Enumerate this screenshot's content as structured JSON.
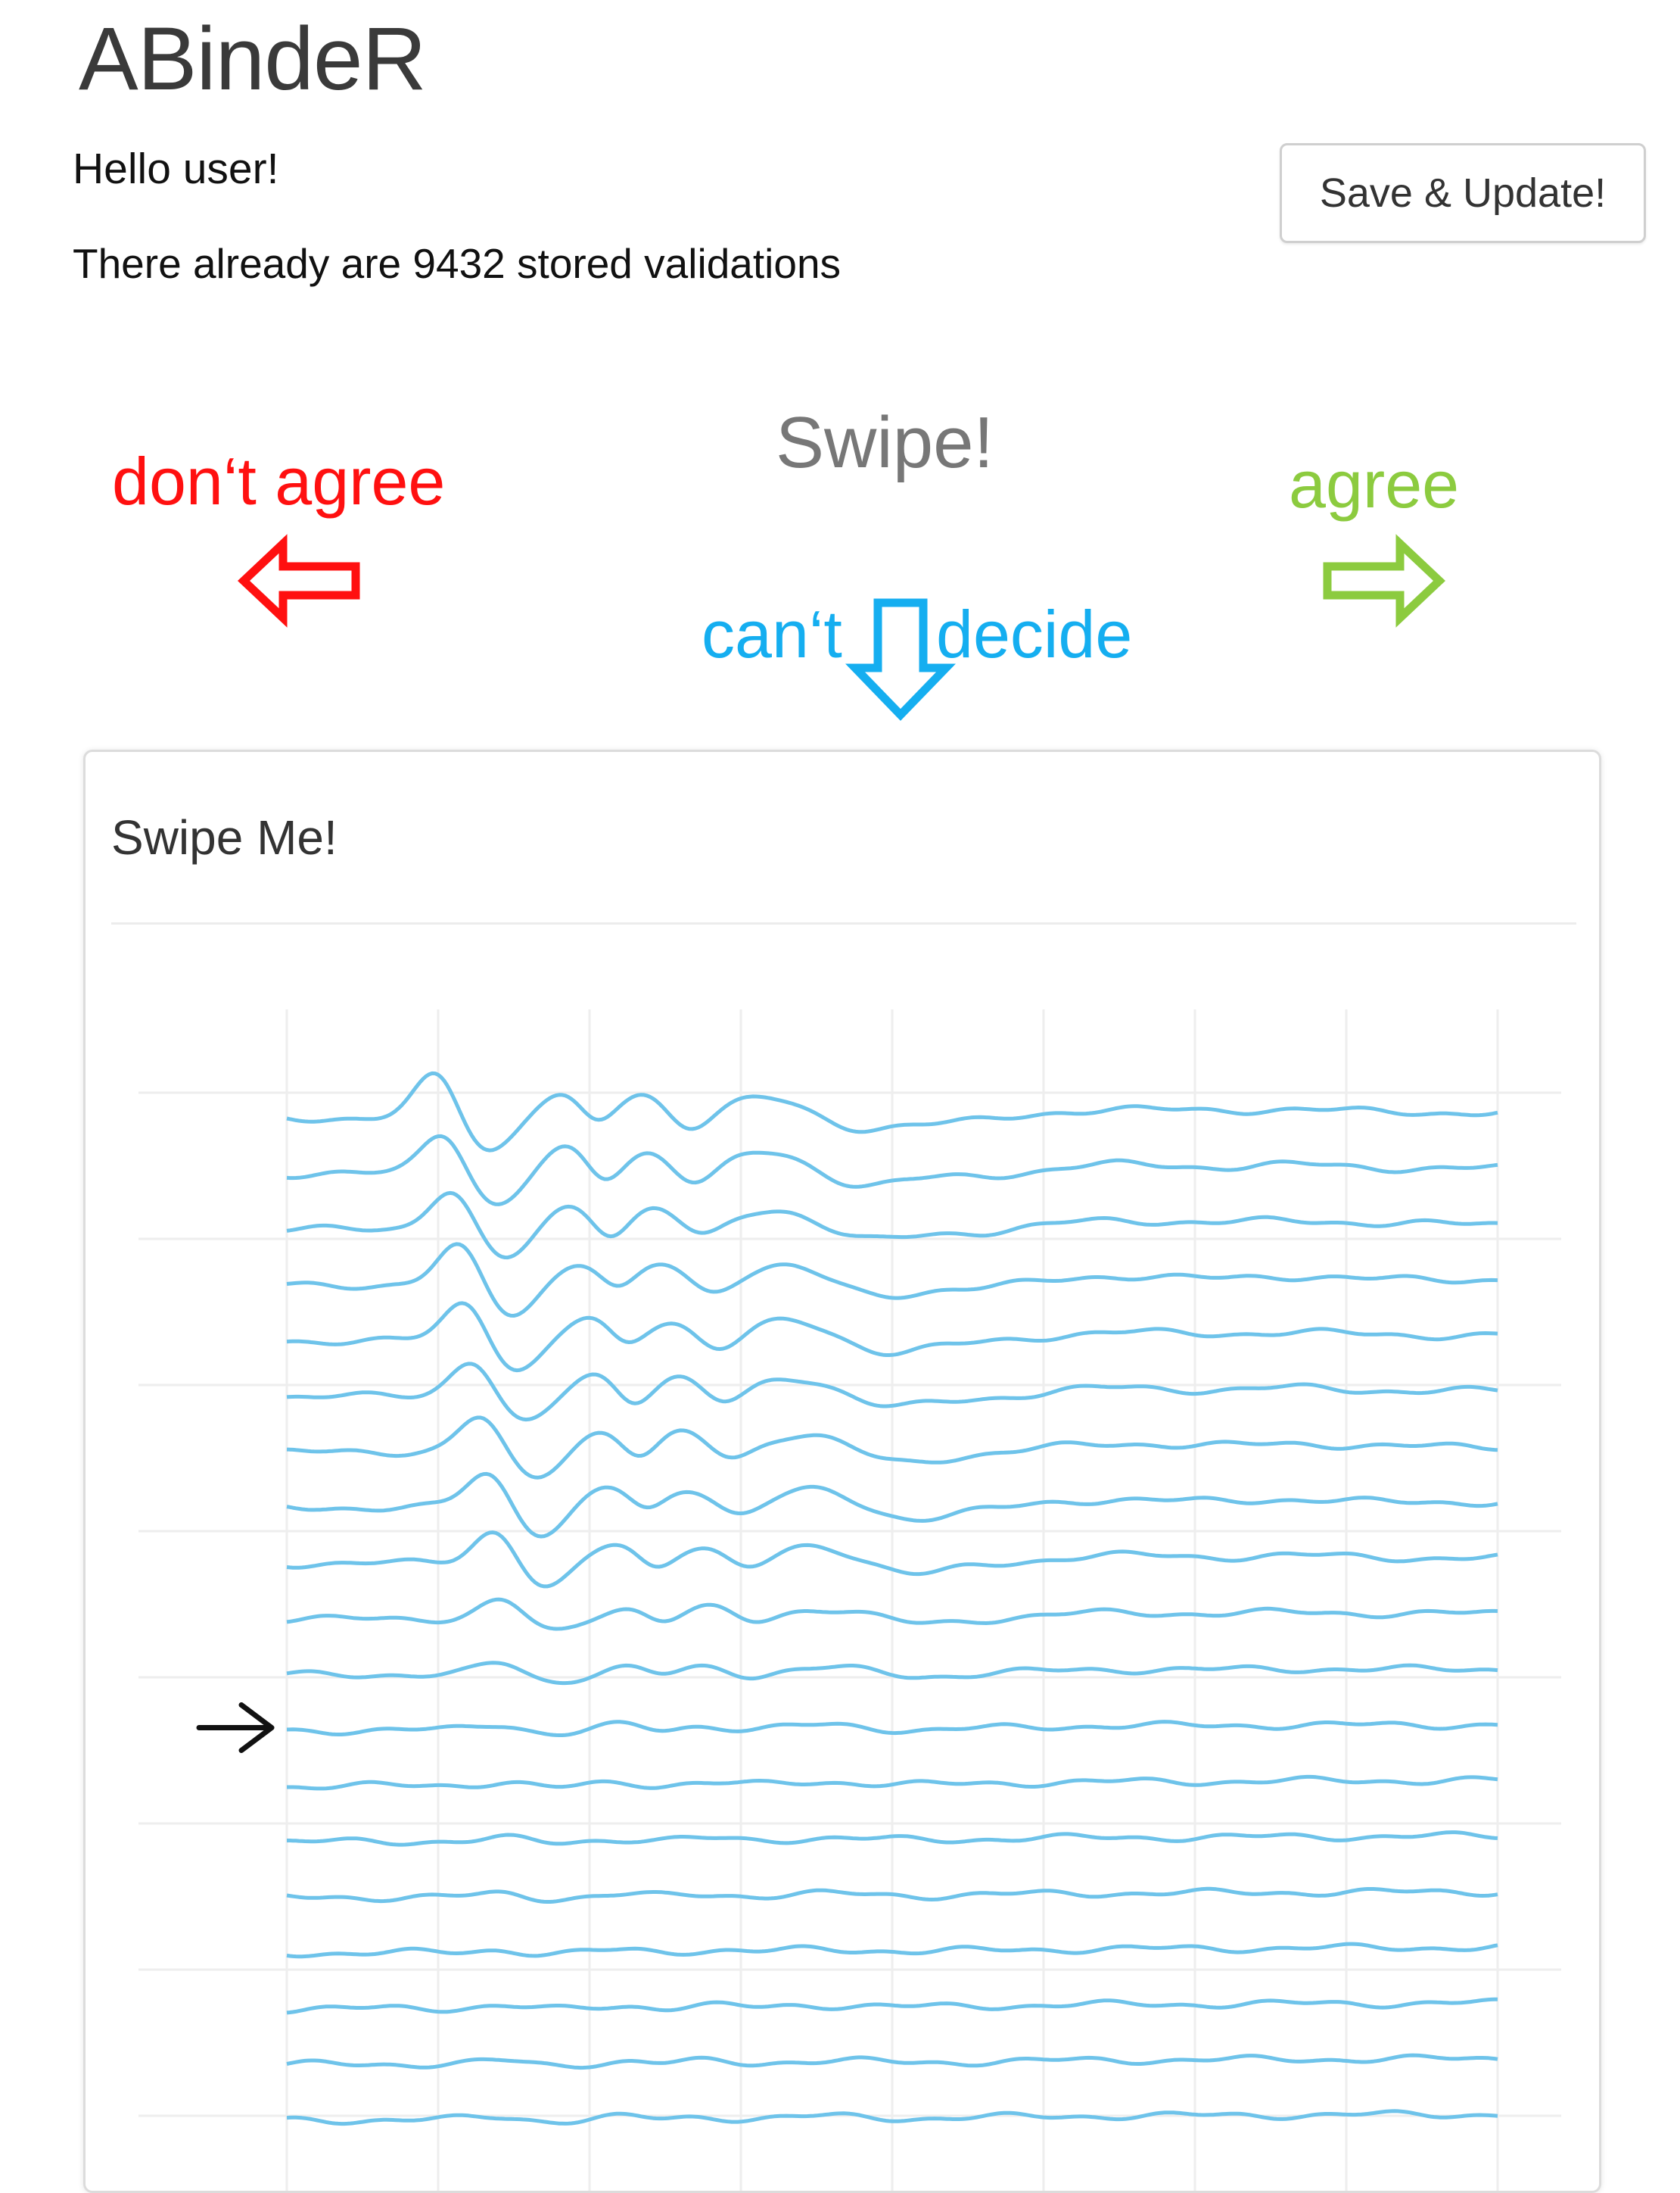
{
  "header": {
    "app_title": "ABindeR",
    "greeting": "Hello user!",
    "stored_validations": "There already are 9432 stored validations",
    "save_button_label": "Save & Update!"
  },
  "swipe_instructions": {
    "hint": "Swipe!",
    "left_label": "don‘t agree",
    "right_label": "agree",
    "down_label_part1": "can‘t",
    "down_label_part2": "decide",
    "left_color": "#ff1010",
    "right_color": "#8ccb3f",
    "down_color": "#15aef0"
  },
  "card": {
    "title": "Swipe Me!",
    "trace_color": "#6ec3ea",
    "trace_count": 19,
    "marked_trace_index": 11
  }
}
